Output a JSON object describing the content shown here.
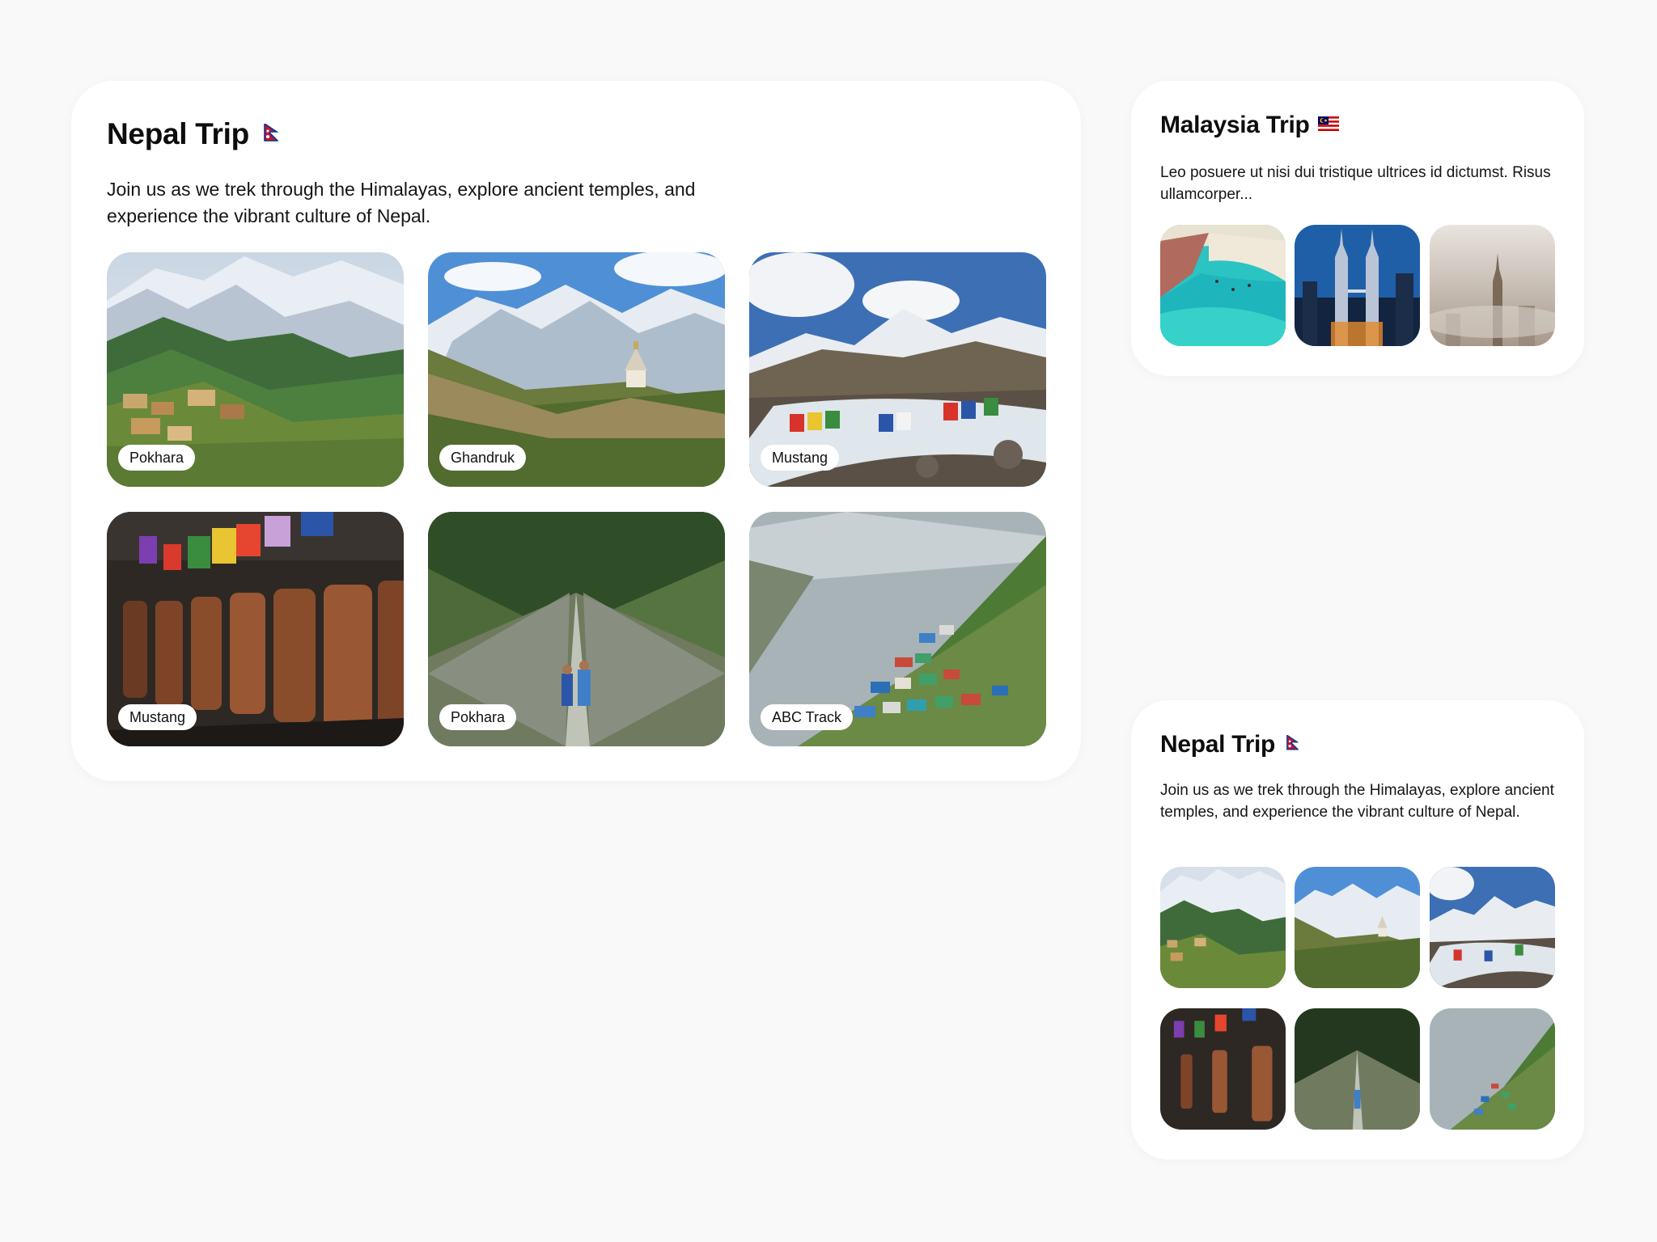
{
  "nepal_card": {
    "title": "Nepal Trip",
    "flag_icon": "nepal-flag-icon",
    "description": "Join us as we trek through the Himalayas, explore ancient temples, and experience the vibrant culture of Nepal.",
    "photos": [
      {
        "label": "Pokhara",
        "scene": "mountain-village"
      },
      {
        "label": "Ghandruk",
        "scene": "mountain-stupa"
      },
      {
        "label": "Mustang",
        "scene": "river-prayer-flags"
      },
      {
        "label": "Mustang",
        "scene": "prayer-wheels"
      },
      {
        "label": "Pokhara",
        "scene": "suspension-bridge"
      },
      {
        "label": "ABC Track",
        "scene": "hillside-town"
      }
    ]
  },
  "malaysia_card": {
    "title": "Malaysia Trip",
    "flag_icon": "malaysia-flag-icon",
    "description": "Leo posuere ut nisi dui tristique ultrices id dictumst. Risus ullamcorper...",
    "photos": [
      {
        "scene": "tropical-beach"
      },
      {
        "scene": "twin-towers-night"
      },
      {
        "scene": "city-fog"
      }
    ]
  },
  "nepal_card_small": {
    "title": "Nepal Trip",
    "flag_icon": "nepal-flag-icon",
    "description": "Join us as we trek through the Himalayas, explore ancient temples, and experience the vibrant culture of Nepal.",
    "photos": [
      {
        "scene": "mountain-village"
      },
      {
        "scene": "mountain-stupa"
      },
      {
        "scene": "river-prayer-flags"
      },
      {
        "scene": "prayer-wheels"
      },
      {
        "scene": "suspension-bridge"
      },
      {
        "scene": "hillside-town"
      }
    ]
  },
  "colors": {
    "page_background": "#f9f9f9",
    "card_background": "#ffffff",
    "nepal_flag_red": "#c8102e",
    "nepal_flag_blue": "#003893",
    "malaysia_flag_red": "#cc0001",
    "malaysia_flag_blue": "#010066",
    "malaysia_flag_yellow": "#ffcc00"
  }
}
